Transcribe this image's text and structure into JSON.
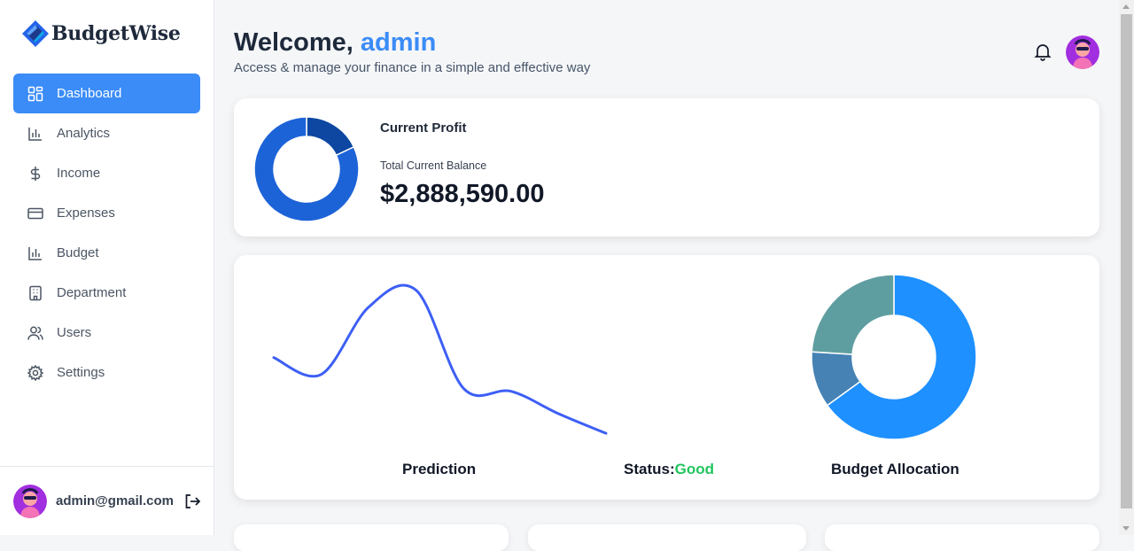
{
  "app": {
    "name": "BudgetWise"
  },
  "sidebar": {
    "items": [
      {
        "label": "Dashboard",
        "icon": "dashboard-icon",
        "active": true
      },
      {
        "label": "Analytics",
        "icon": "bar-chart-icon",
        "active": false
      },
      {
        "label": "Income",
        "icon": "dollar-icon",
        "active": false
      },
      {
        "label": "Expenses",
        "icon": "credit-card-icon",
        "active": false
      },
      {
        "label": "Budget",
        "icon": "bar-chart-icon",
        "active": false
      },
      {
        "label": "Department",
        "icon": "building-icon",
        "active": false
      },
      {
        "label": "Users",
        "icon": "users-icon",
        "active": false
      },
      {
        "label": "Settings",
        "icon": "gear-icon",
        "active": false
      }
    ],
    "footer": {
      "email": "admin@gmail.com"
    }
  },
  "header": {
    "welcome": "Welcome,",
    "username": "admin",
    "subtitle": "Access & manage your finance in a simple and effective way"
  },
  "profit_card": {
    "title": "Current Profit",
    "balance_label": "Total Current Balance",
    "balance_value": "$2,888,590.00"
  },
  "charts_card": {
    "prediction_label": "Prediction",
    "status_label": "Status:",
    "status_value": "Good",
    "allocation_label": "Budget Allocation"
  },
  "chart_data": [
    {
      "type": "pie",
      "title": "",
      "donut": true,
      "values": [
        18,
        82
      ],
      "colors": [
        "#0d47a1",
        "#1d63d8"
      ]
    },
    {
      "type": "line",
      "title": "",
      "x": [
        0,
        1,
        2,
        3,
        4,
        5,
        6,
        7
      ],
      "values": [
        2.2,
        1.6,
        4.0,
        4.6,
        1.1,
        1.0,
        0.2,
        -0.5
      ],
      "colors": [
        "#3d5ff5"
      ]
    },
    {
      "type": "pie",
      "title": "",
      "donut": true,
      "values": [
        65,
        11,
        24
      ],
      "colors": [
        "#1e90ff",
        "#4682b4",
        "#5f9ea0"
      ]
    }
  ],
  "colors": {
    "accent": "#3b8cf7",
    "good": "#22c55e"
  }
}
